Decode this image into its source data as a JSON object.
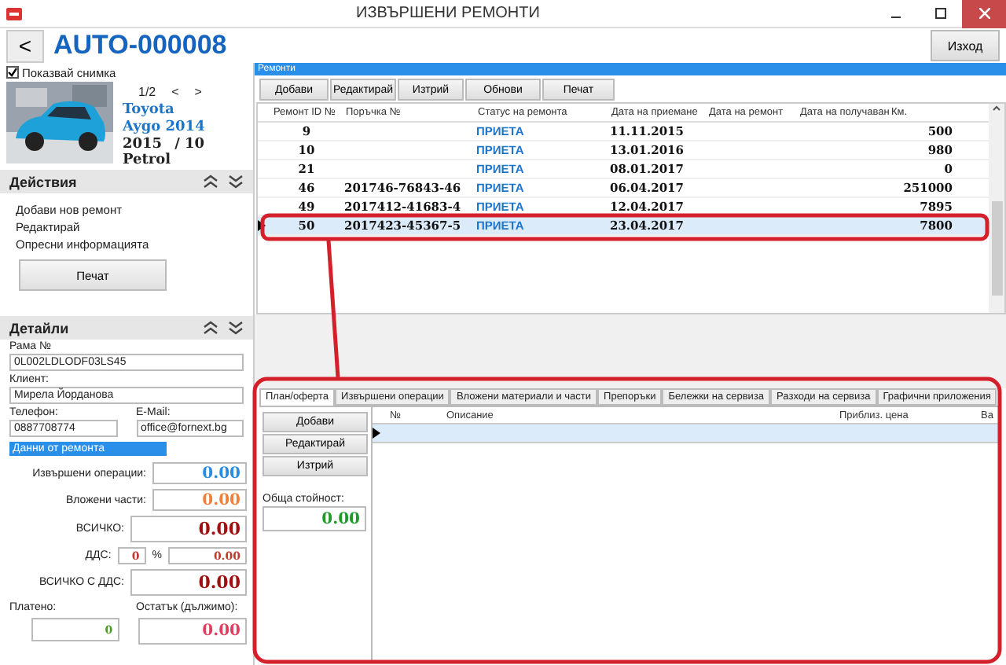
{
  "window": {
    "title": "ИЗВЪРШЕНИ РЕМОНТИ"
  },
  "header": {
    "back": "<",
    "code": "AUTO-000008",
    "exit": "Изход"
  },
  "vehicle": {
    "show_photo": {
      "label": "Показвай снимка",
      "checked": true
    },
    "pager": "1/2",
    "prev": "<",
    "next": ">",
    "make": "Toyota",
    "model": "Aygo 2014",
    "year": "2015",
    "month": "/ 10",
    "fuel": "Petrol"
  },
  "actions": {
    "title": "Действия",
    "items": [
      "Добави нов ремонт",
      "Редактирай",
      "Опресни информацията"
    ],
    "print": "Печат"
  },
  "details": {
    "title": "Детайли",
    "vin_label": "Рама №",
    "vin": "0L002LDLODF03LS45",
    "client_label": "Клиент:",
    "client": "Мирела Йорданова",
    "phone_label": "Телефон:",
    "phone": "0887708774",
    "email_label": "E-Mail:",
    "email": "office@fornext.bg",
    "section": "Данни от ремонта",
    "summary": [
      {
        "label": "Извършени операции:",
        "value": "0.00",
        "color": "#2b8be0",
        "kind": "subtotal"
      },
      {
        "label": "Вложени части:",
        "value": "0.00",
        "color": "#f07f3a",
        "kind": "subtotal"
      },
      {
        "label": "ВСИЧКО:",
        "value": "0.00",
        "color": "#a01010",
        "kind": "total"
      }
    ],
    "vat_label": "ДДС:",
    "vat_percent": "0",
    "percent_sign": "%",
    "vat_value": "0.00",
    "total_vat_label": "ВСИЧКО С ДДС:",
    "total_vat": "0.00",
    "paid_label": "Платено:",
    "paid": "0",
    "remainder_label": "Остатък (дължимо):",
    "remainder": "0.00"
  },
  "repairs": {
    "title": "Ремонти",
    "buttons": [
      "Добави",
      "Редактирай",
      "Изтрий",
      "Обнови",
      "Печат"
    ],
    "columns": [
      "Ремонт ID №",
      "Поръчка №",
      "Статус на ремонта",
      "Дата на приемане",
      "Дата на ремонт",
      "Дата на получаван",
      "Км."
    ],
    "rows": [
      {
        "cells": [
          "9",
          "",
          "ПРИЕТА",
          "11.11.2015",
          "",
          "",
          "500"
        ],
        "selected": false
      },
      {
        "cells": [
          "10",
          "",
          "ПРИЕТА",
          "13.01.2016",
          "",
          "",
          "980"
        ],
        "selected": false
      },
      {
        "cells": [
          "21",
          "",
          "ПРИЕТА",
          "08.01.2017",
          "",
          "",
          "0"
        ],
        "selected": false
      },
      {
        "cells": [
          "46",
          "201746-76843-46",
          "ПРИЕТА",
          "06.04.2017",
          "",
          "",
          "251000"
        ],
        "selected": false
      },
      {
        "cells": [
          "49",
          "2017412-41683-4",
          "ПРИЕТА",
          "12.04.2017",
          "",
          "",
          "7895"
        ],
        "selected": false
      },
      {
        "cells": [
          "50",
          "2017423-45367-5",
          "ПРИЕТА",
          "23.04.2017",
          "",
          "",
          "7800"
        ],
        "selected": true
      }
    ]
  },
  "tabs": [
    {
      "label": "План/оферта",
      "selected": true
    },
    {
      "label": "Извършени операции",
      "selected": false
    },
    {
      "label": "Вложени материали и части",
      "selected": false
    },
    {
      "label": "Препоръки",
      "selected": false
    },
    {
      "label": "Бележки на сервиза",
      "selected": false
    },
    {
      "label": "Разходи на сервиза",
      "selected": false
    },
    {
      "label": "Графични приложения",
      "selected": false
    }
  ],
  "tab_panel": {
    "buttons": [
      "Добави",
      "Редактирай",
      "Изтрий"
    ],
    "total_label": "Обща стойност:",
    "total": "0.00",
    "columns": [
      "№",
      "Описание",
      "Приблиз. цена",
      "Ва"
    ],
    "rows": [
      {
        "selected": true
      }
    ]
  }
}
